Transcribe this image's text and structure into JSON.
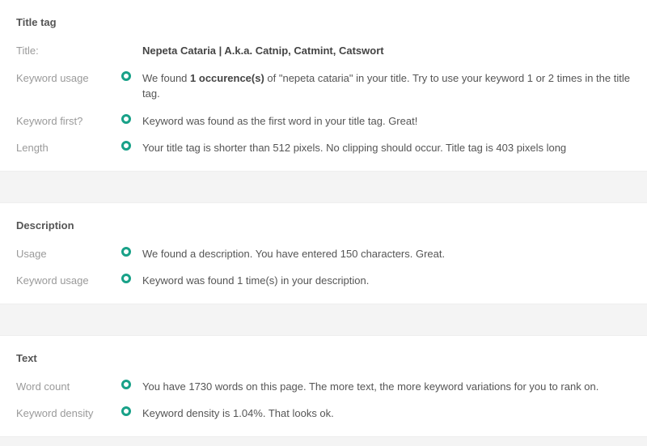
{
  "title_tag": {
    "heading": "Title tag",
    "rows": {
      "title": {
        "label": "Title:",
        "value": "Nepeta Cataria | A.k.a. Catnip, Catmint, Catswort"
      },
      "keyword_usage": {
        "label": "Keyword usage",
        "before": "We found ",
        "bold": "1 occurence(s)",
        "after": " of \"nepeta cataria\" in your title. Try to use your keyword 1 or 2 times in the title tag."
      },
      "keyword_first": {
        "label": "Keyword first?",
        "value": "Keyword was found as the first word in your title tag. Great!"
      },
      "length": {
        "label": "Length",
        "value": "Your title tag is shorter than 512 pixels. No clipping should occur. Title tag is 403 pixels long"
      }
    }
  },
  "description": {
    "heading": "Description",
    "rows": {
      "usage": {
        "label": "Usage",
        "value": "We found a description. You have entered 150 characters. Great."
      },
      "keyword_usage": {
        "label": "Keyword usage",
        "value": "Keyword was found 1 time(s) in your description."
      }
    }
  },
  "text": {
    "heading": "Text",
    "rows": {
      "word_count": {
        "label": "Word count",
        "value": "You have 1730 words on this page. The more text, the more keyword variations for you to rank on."
      },
      "keyword_density": {
        "label": "Keyword density",
        "value": "Keyword density is 1.04%. That looks ok."
      }
    }
  }
}
